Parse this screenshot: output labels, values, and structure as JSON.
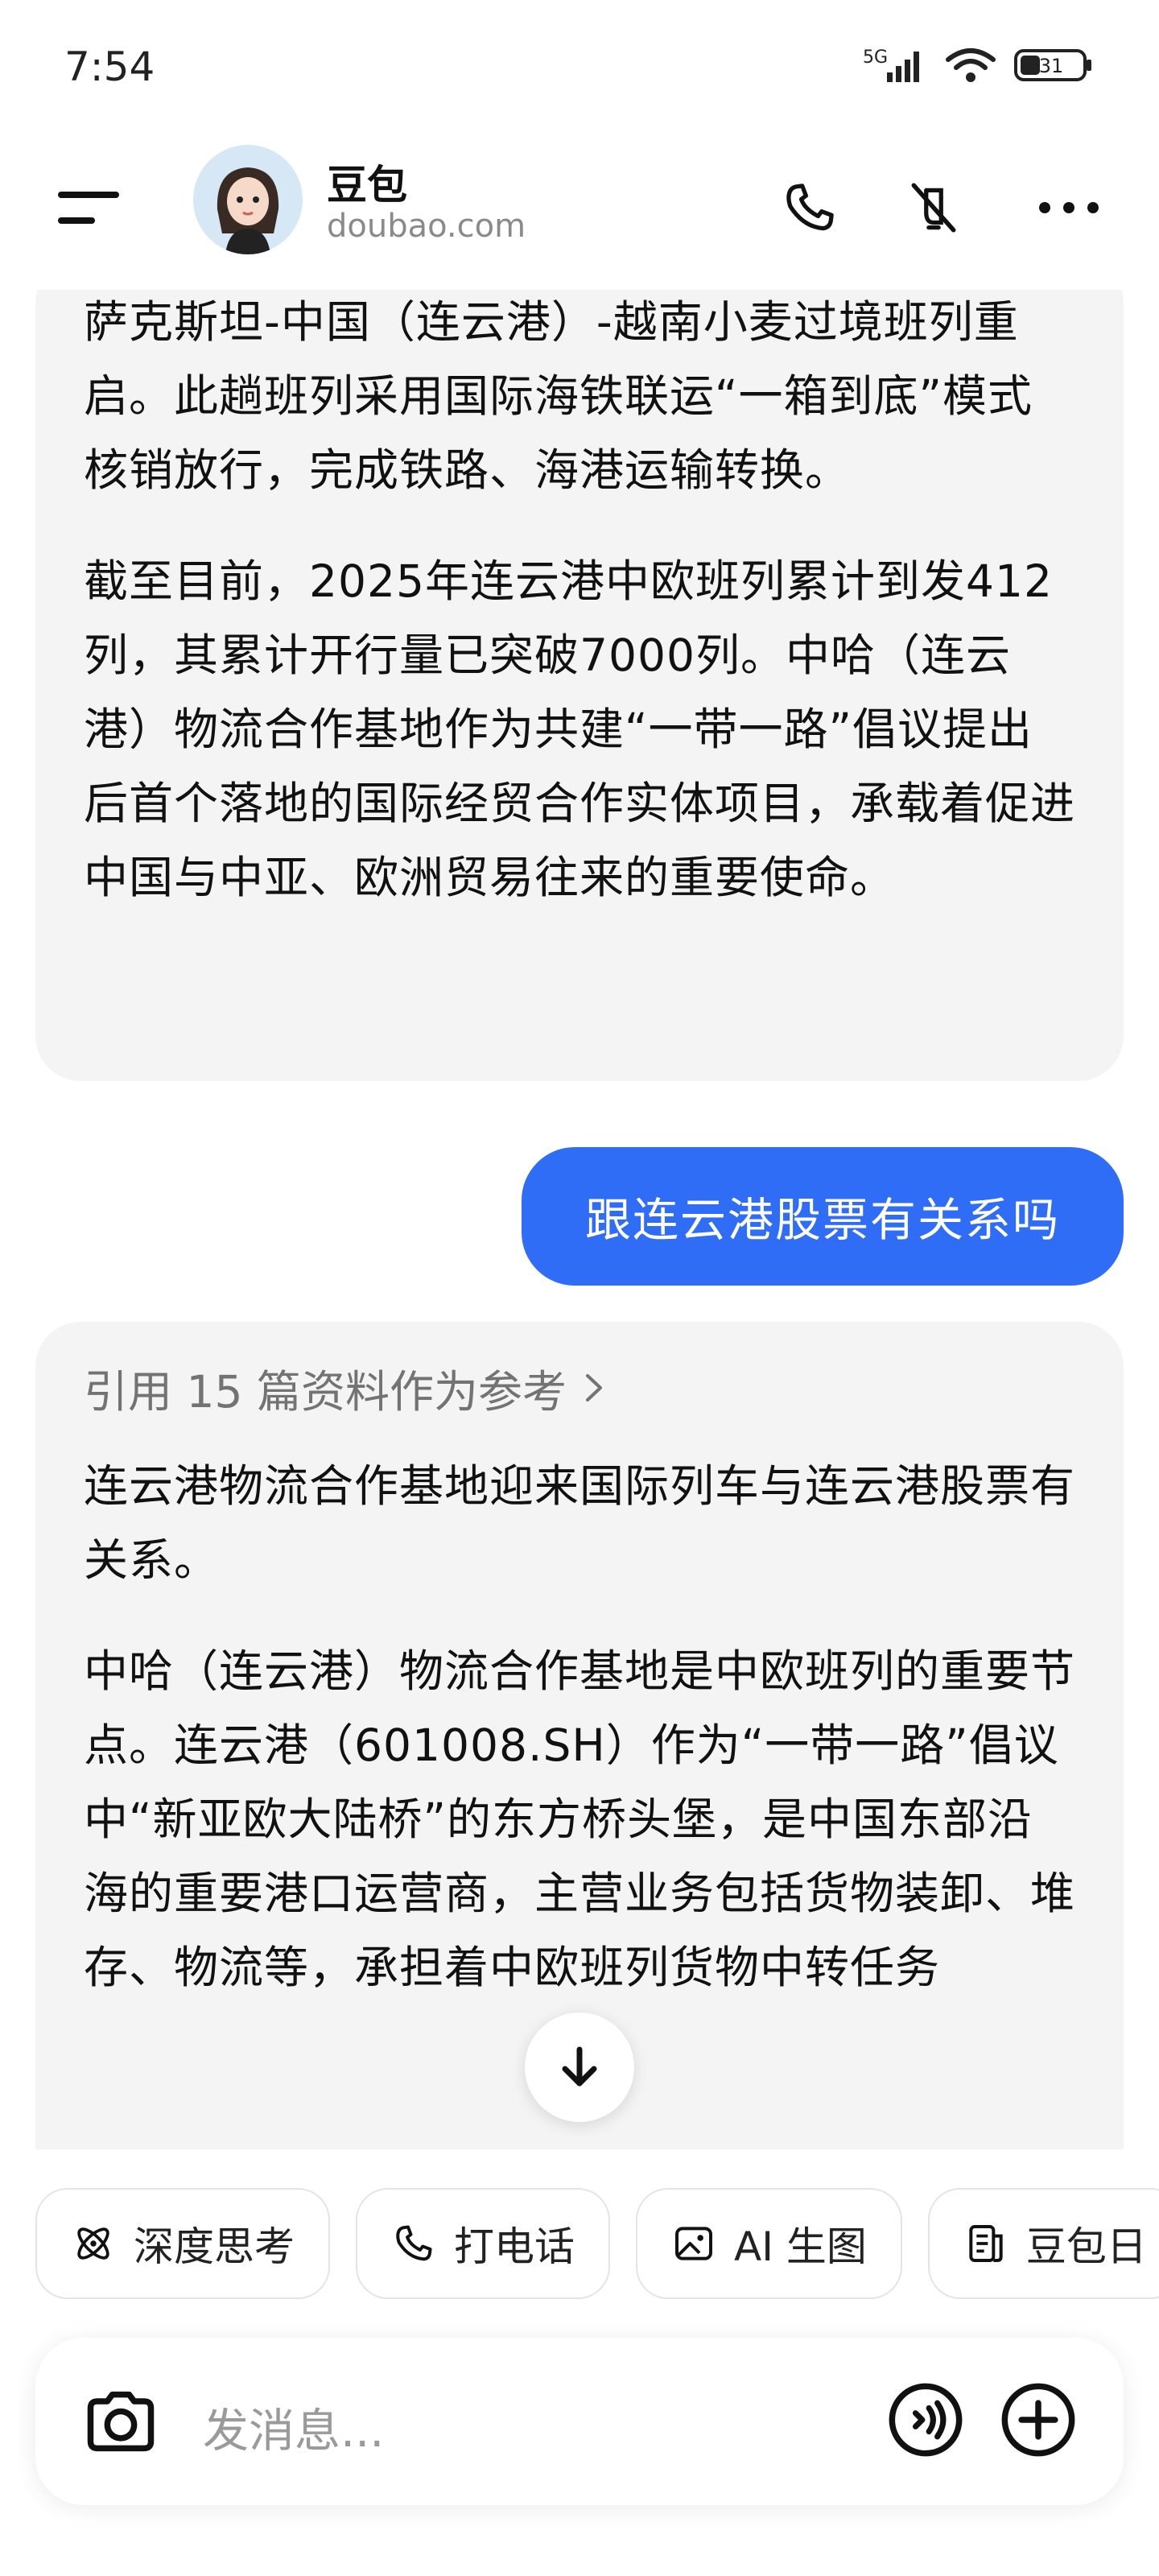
{
  "status": {
    "time": "7:54",
    "network": "5G",
    "battery": "31"
  },
  "header": {
    "name": "豆包",
    "domain": "doubao.com"
  },
  "messages": {
    "ai_top": {
      "paragraphs": [
        "萨克斯坦-中国（连云港）-越南小麦过境班列重启。此趟班列采用国际海铁联运“一箱到底”模式核销放行，完成铁路、海港运输转换。",
        "截至目前，2025年连云港中欧班列累计到发412列，其累计开行量已突破7000列。中哈（连云港）物流合作基地作为共建“一带一路”倡议提出后首个落地的国际经贸合作实体项目，承载着促进中国与中亚、欧洲贸易往来的重要使命。"
      ]
    },
    "user": "跟连云港股票有关系吗",
    "ai_bottom": {
      "references": "引用 15 篇资料作为参考",
      "paragraphs": [
        "连云港物流合作基地迎来国际列车与连云港股票有关系。",
        "中哈（连云港）物流合作基地是中欧班列的重要节点。连云港（601008.SH）作为“一带一路”倡议中“新亚欧大陆桥”的东方桥头堡，是中国东部沿海的重要港口运营商，主营业务包括货物装卸、堆存、物流等，承担着中欧班列货物中转任务"
      ]
    }
  },
  "chips": [
    {
      "label": "深度思考",
      "icon": "atom-icon"
    },
    {
      "label": "打电话",
      "icon": "phone-icon"
    },
    {
      "label": "AI 生图",
      "icon": "image-icon"
    },
    {
      "label": "豆包日",
      "icon": "document-icon"
    }
  ],
  "composer": {
    "placeholder": "发消息..."
  },
  "colors": {
    "accent": "#2f6df6",
    "bubble_ai": "#f4f4f5"
  }
}
